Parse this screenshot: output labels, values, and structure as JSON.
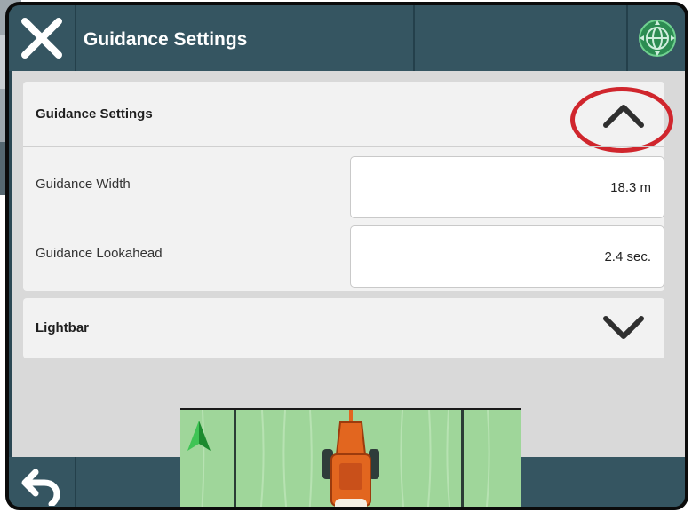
{
  "header": {
    "title": "Guidance Settings"
  },
  "sections": {
    "guidance": {
      "label": "Guidance Settings",
      "expanded": true,
      "rows": [
        {
          "label": "Guidance Width",
          "value": "18.3 m"
        },
        {
          "label": "Guidance Lookahead",
          "value": "2.4 sec."
        }
      ]
    },
    "lightbar": {
      "label": "Lightbar",
      "expanded": false
    }
  },
  "colors": {
    "header_bg": "#355561",
    "panel_bg": "#d9d9d9",
    "highlight": "#d0262d",
    "field_green": "#9fd69a",
    "vehicle_orange": "#e2661f"
  },
  "icons": {
    "close": "close-icon",
    "globe": "globe-icon",
    "collapse": "chevron-up-icon",
    "expand": "chevron-down-icon",
    "back": "back-arrow-icon",
    "north": "north-arrow-icon",
    "vehicle": "tractor-icon"
  }
}
